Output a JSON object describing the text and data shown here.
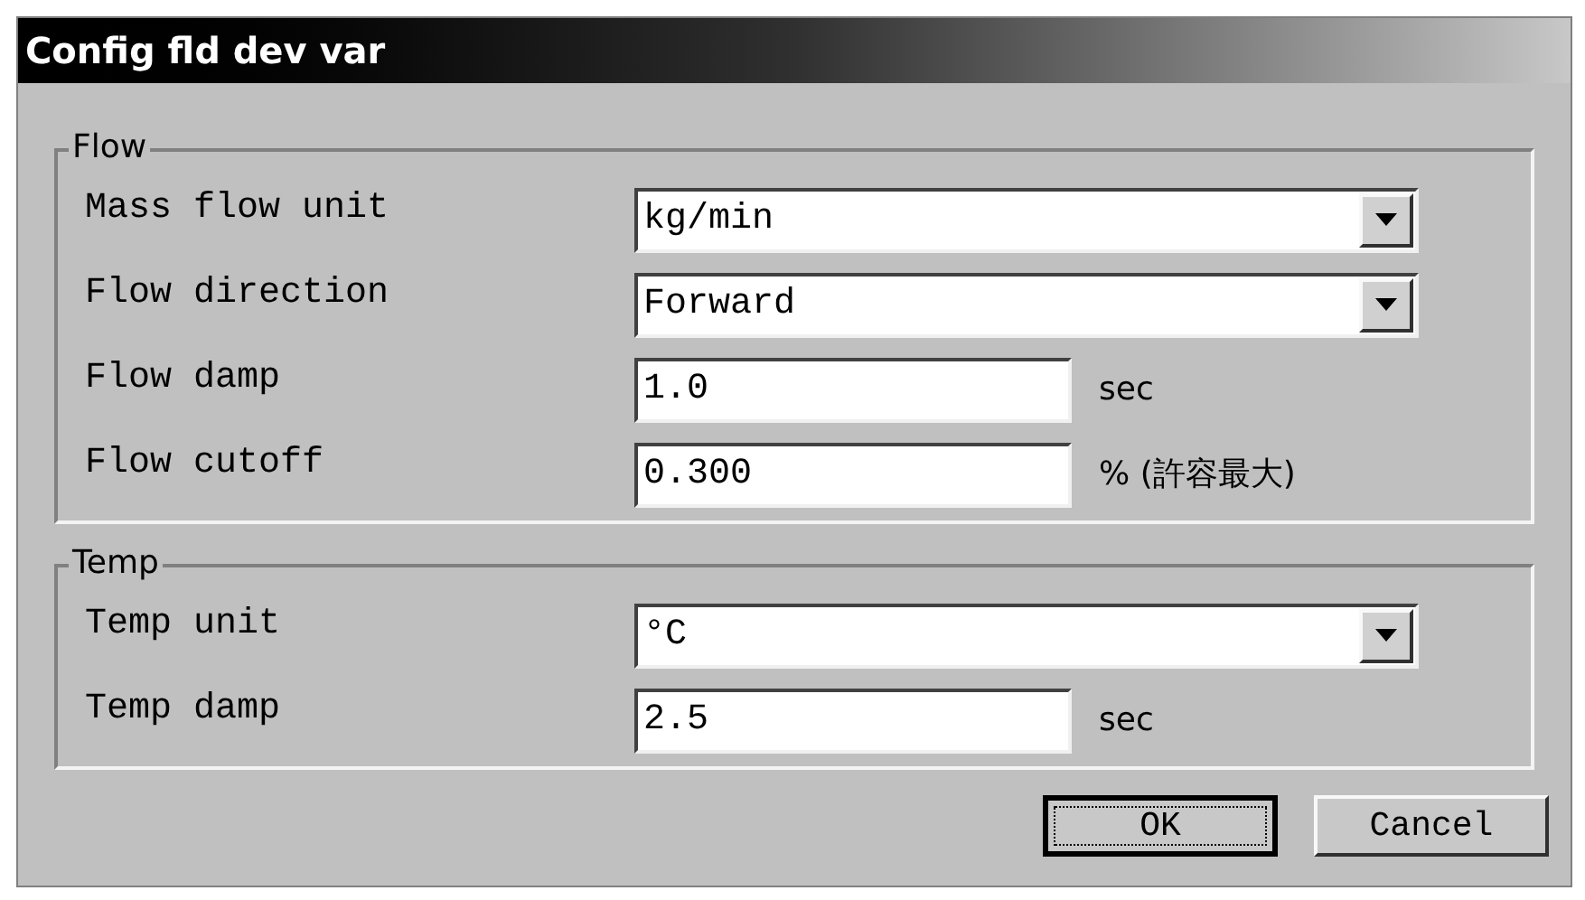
{
  "window": {
    "title": "Config fld dev var"
  },
  "groups": [
    {
      "label": "Flow",
      "rows": [
        {
          "kind": "dropdown",
          "label": "Mass flow unit",
          "value": "kg/min"
        },
        {
          "kind": "dropdown",
          "label": "Flow direction",
          "value": "Forward"
        },
        {
          "kind": "text",
          "label": "Flow damp",
          "value": "1.0",
          "unit": "sec"
        },
        {
          "kind": "text",
          "label": "Flow cutoff",
          "value": "0.300",
          "unit": "% (許容最大)"
        }
      ]
    },
    {
      "label": "Temp",
      "rows": [
        {
          "kind": "dropdown",
          "label": "Temp unit",
          "value": "°C"
        },
        {
          "kind": "text",
          "label": "Temp damp",
          "value": "2.5",
          "unit": "sec"
        }
      ]
    }
  ],
  "buttons": [
    {
      "label": "OK",
      "focused": true
    },
    {
      "label": "Cancel",
      "focused": false
    }
  ]
}
